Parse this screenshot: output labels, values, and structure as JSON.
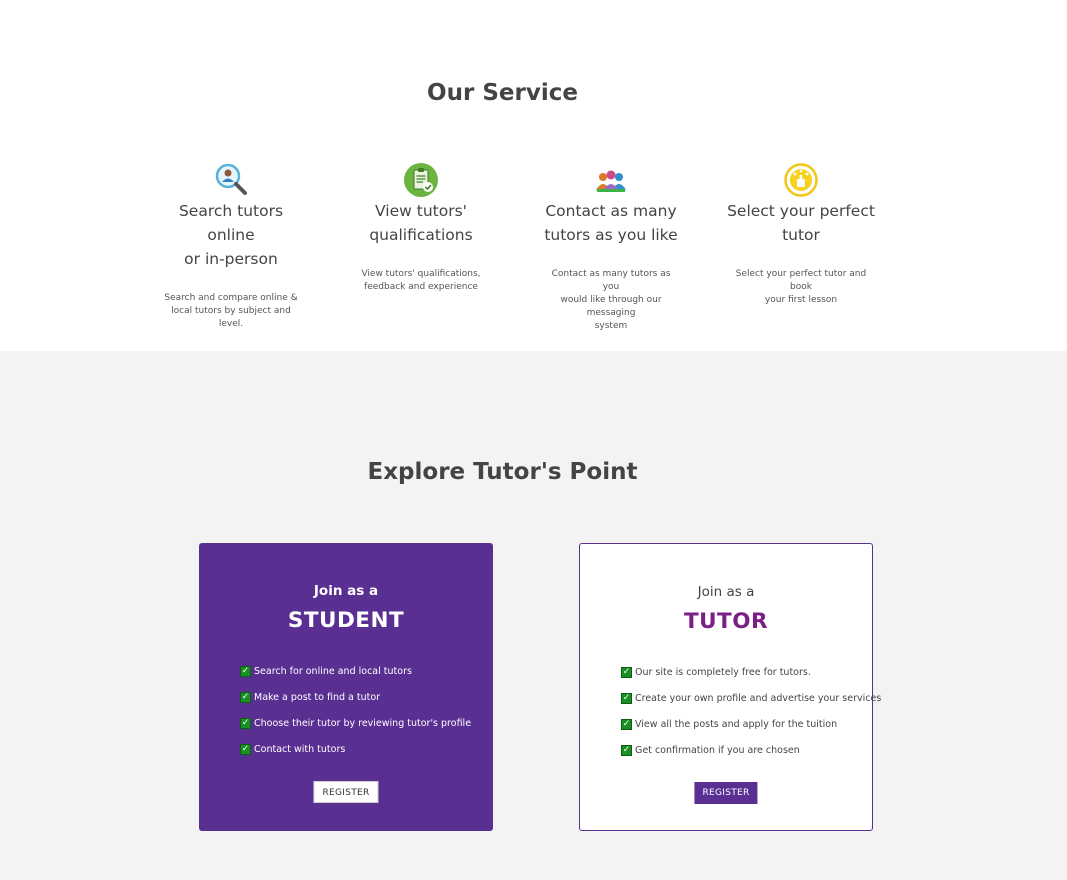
{
  "service": {
    "title": "Our Service",
    "items": [
      {
        "icon": "search-person-icon",
        "title_line1": "Search tutors online",
        "title_line2": "or in-person",
        "desc_line1": "Search and compare online &",
        "desc_line2": "local tutors by subject and level.",
        "desc_line3": ""
      },
      {
        "icon": "clipboard-check-icon",
        "title_line1": "View tutors'",
        "title_line2": "qualifications",
        "desc_line1": "View tutors' qualifications,",
        "desc_line2": "feedback and experience",
        "desc_line3": ""
      },
      {
        "icon": "people-group-icon",
        "title_line1": "Contact as many",
        "title_line2": "tutors as you like",
        "desc_line1": "Contact as many tutors as you",
        "desc_line2": "would like through our messaging",
        "desc_line3": "system"
      },
      {
        "icon": "selection-hand-icon",
        "title_line1": "Select your perfect",
        "title_line2": "tutor",
        "desc_line1": "Select your perfect tutor and book",
        "desc_line2": "your first lesson",
        "desc_line3": ""
      }
    ]
  },
  "explore": {
    "title": "Explore Tutor's Point",
    "student": {
      "join": "Join as a",
      "role": "STUDENT",
      "features": [
        "Search for online and local tutors",
        "Make a post to find a tutor",
        "Choose their tutor by reviewing tutor's profile",
        "Contact with tutors"
      ],
      "button": "REGISTER"
    },
    "tutor": {
      "join": "Join as a",
      "role": "TUTOR",
      "features": [
        "Our site is completely free for tutors.",
        "Create your own profile and advertise your services",
        "View all the posts and apply for the tuition",
        "Get confirmation if you are chosen"
      ],
      "button": "REGISTER"
    }
  },
  "colors": {
    "brand_purple": "#5a2f92",
    "tutor_heading": "#7a1f86",
    "check_green": "#1a8f24",
    "section_gray": "#f3f3f3"
  }
}
